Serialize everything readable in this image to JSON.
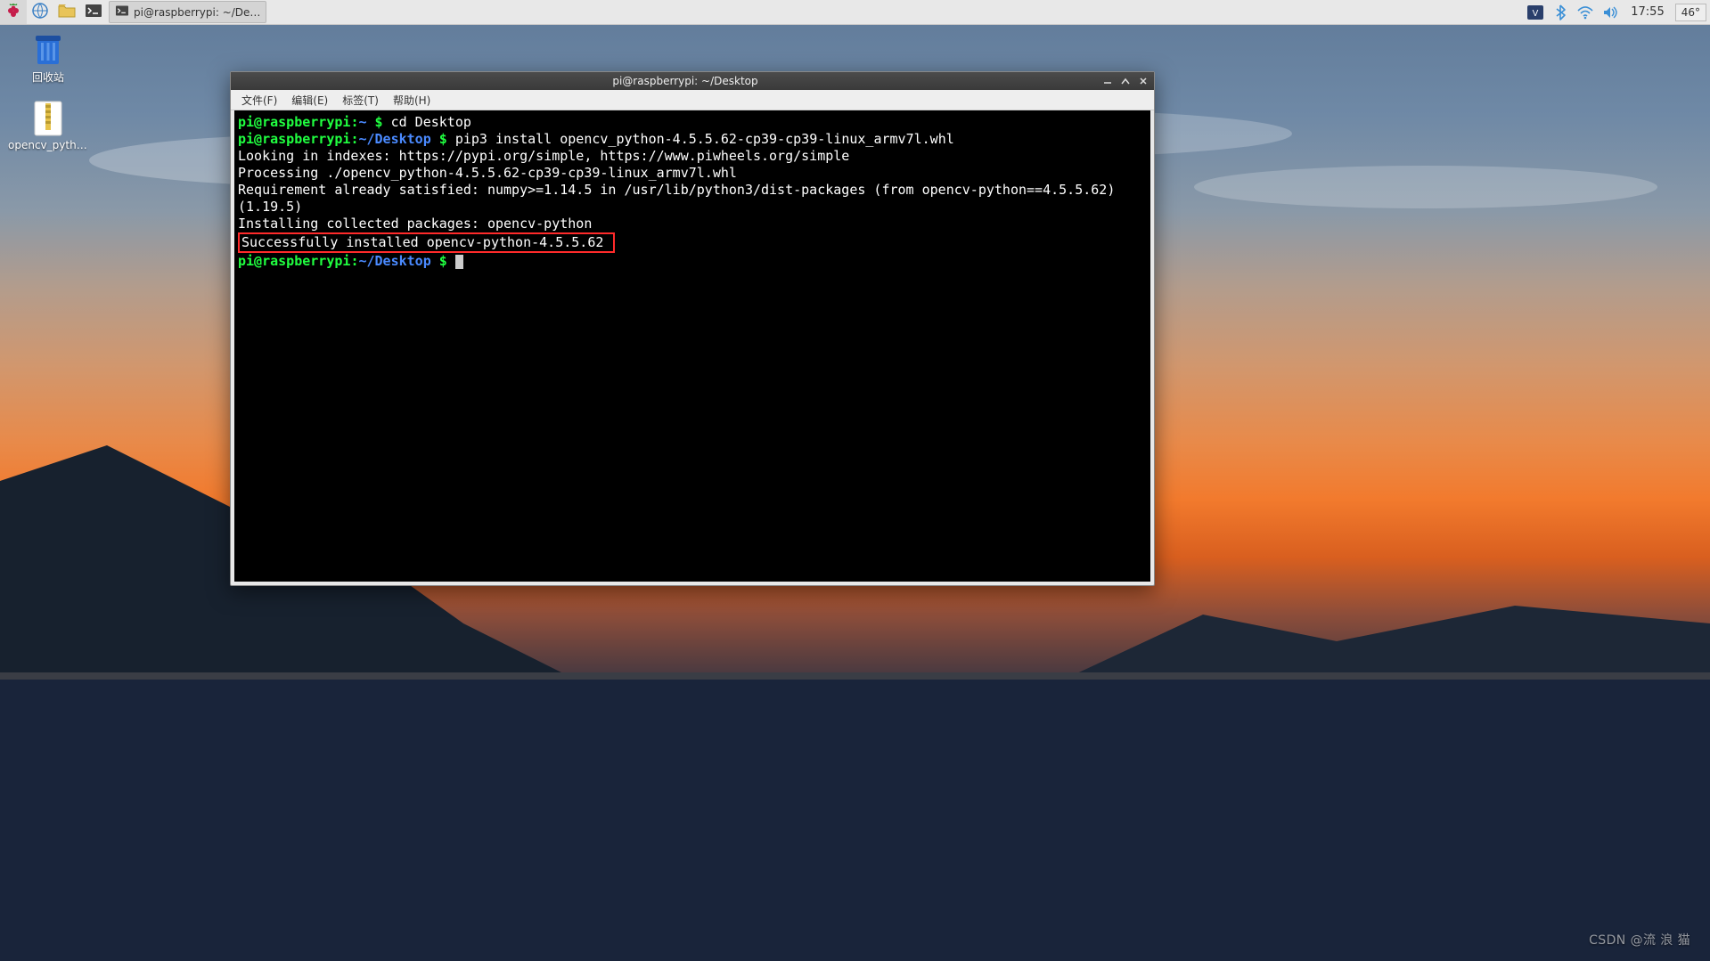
{
  "taskbar": {
    "app_label": "pi@raspberrypi: ~/De…"
  },
  "tray": {
    "clock": "17:55",
    "temp": "46°"
  },
  "desktop_icons": {
    "trash": "回收站",
    "file": "opencv_python…"
  },
  "window": {
    "title": "pi@raspberrypi: ~/Desktop",
    "menus": {
      "file": "文件(F)",
      "edit": "编辑(E)",
      "tabs": "标签(T)",
      "help": "帮助(H)"
    }
  },
  "terminal": {
    "prompt1_user": "pi@raspberrypi",
    "prompt1_path": "~",
    "cmd1": "cd Desktop",
    "prompt2_user": "pi@raspberrypi",
    "prompt2_path": "~/Desktop",
    "cmd2": "pip3 install opencv_python-4.5.5.62-cp39-cp39-linux_armv7l.whl",
    "out1": "Looking in indexes: https://pypi.org/simple, https://www.piwheels.org/simple",
    "out2": "Processing ./opencv_python-4.5.5.62-cp39-cp39-linux_armv7l.whl",
    "out3": "Requirement already satisfied: numpy>=1.14.5 in /usr/lib/python3/dist-packages (from opencv-python==4.5.5.62) (1.19.5)",
    "out4": "Installing collected packages: opencv-python",
    "out5": "Successfully installed opencv-python-4.5.5.62 ",
    "prompt3_user": "pi@raspberrypi",
    "prompt3_path": "~/Desktop"
  },
  "watermark": "CSDN @流 浪 猫"
}
